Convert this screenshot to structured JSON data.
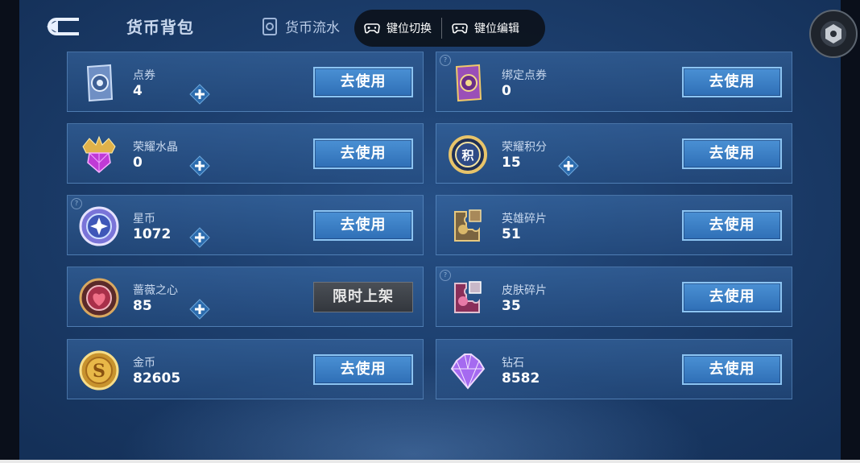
{
  "header": {
    "title": "货币背包",
    "tab_currency_flow": "货币流水"
  },
  "overlay": {
    "key_switch": "键位切换",
    "key_edit": "键位编辑"
  },
  "currencies": [
    {
      "name": "点券",
      "value": "4",
      "action": "去使用",
      "icon": "ticket-icon"
    },
    {
      "name": "绑定点券",
      "value": "0",
      "action": "去使用",
      "icon": "bound-ticket-icon"
    },
    {
      "name": "荣耀水晶",
      "value": "0",
      "action": "去使用",
      "icon": "glory-crystal-icon"
    },
    {
      "name": "荣耀积分",
      "value": "15",
      "action": "去使用",
      "icon": "glory-points-icon"
    },
    {
      "name": "星币",
      "value": "1072",
      "action": "去使用",
      "icon": "star-coin-icon"
    },
    {
      "name": "英雄碎片",
      "value": "51",
      "action": "去使用",
      "icon": "hero-fragment-icon"
    },
    {
      "name": "蔷薇之心",
      "value": "85",
      "action": "限时上架",
      "icon": "rose-heart-icon"
    },
    {
      "name": "皮肤碎片",
      "value": "35",
      "action": "去使用",
      "icon": "skin-fragment-icon"
    },
    {
      "name": "金币",
      "value": "82605",
      "action": "去使用",
      "icon": "gold-coin-icon"
    },
    {
      "name": "钻石",
      "value": "8582",
      "action": "去使用",
      "icon": "diamond-icon"
    }
  ],
  "colors": {
    "background": "#1d3f6e",
    "button_blue": "#3a7fc6",
    "button_border": "#8cc4f2",
    "limited_button": "#3f444b"
  }
}
